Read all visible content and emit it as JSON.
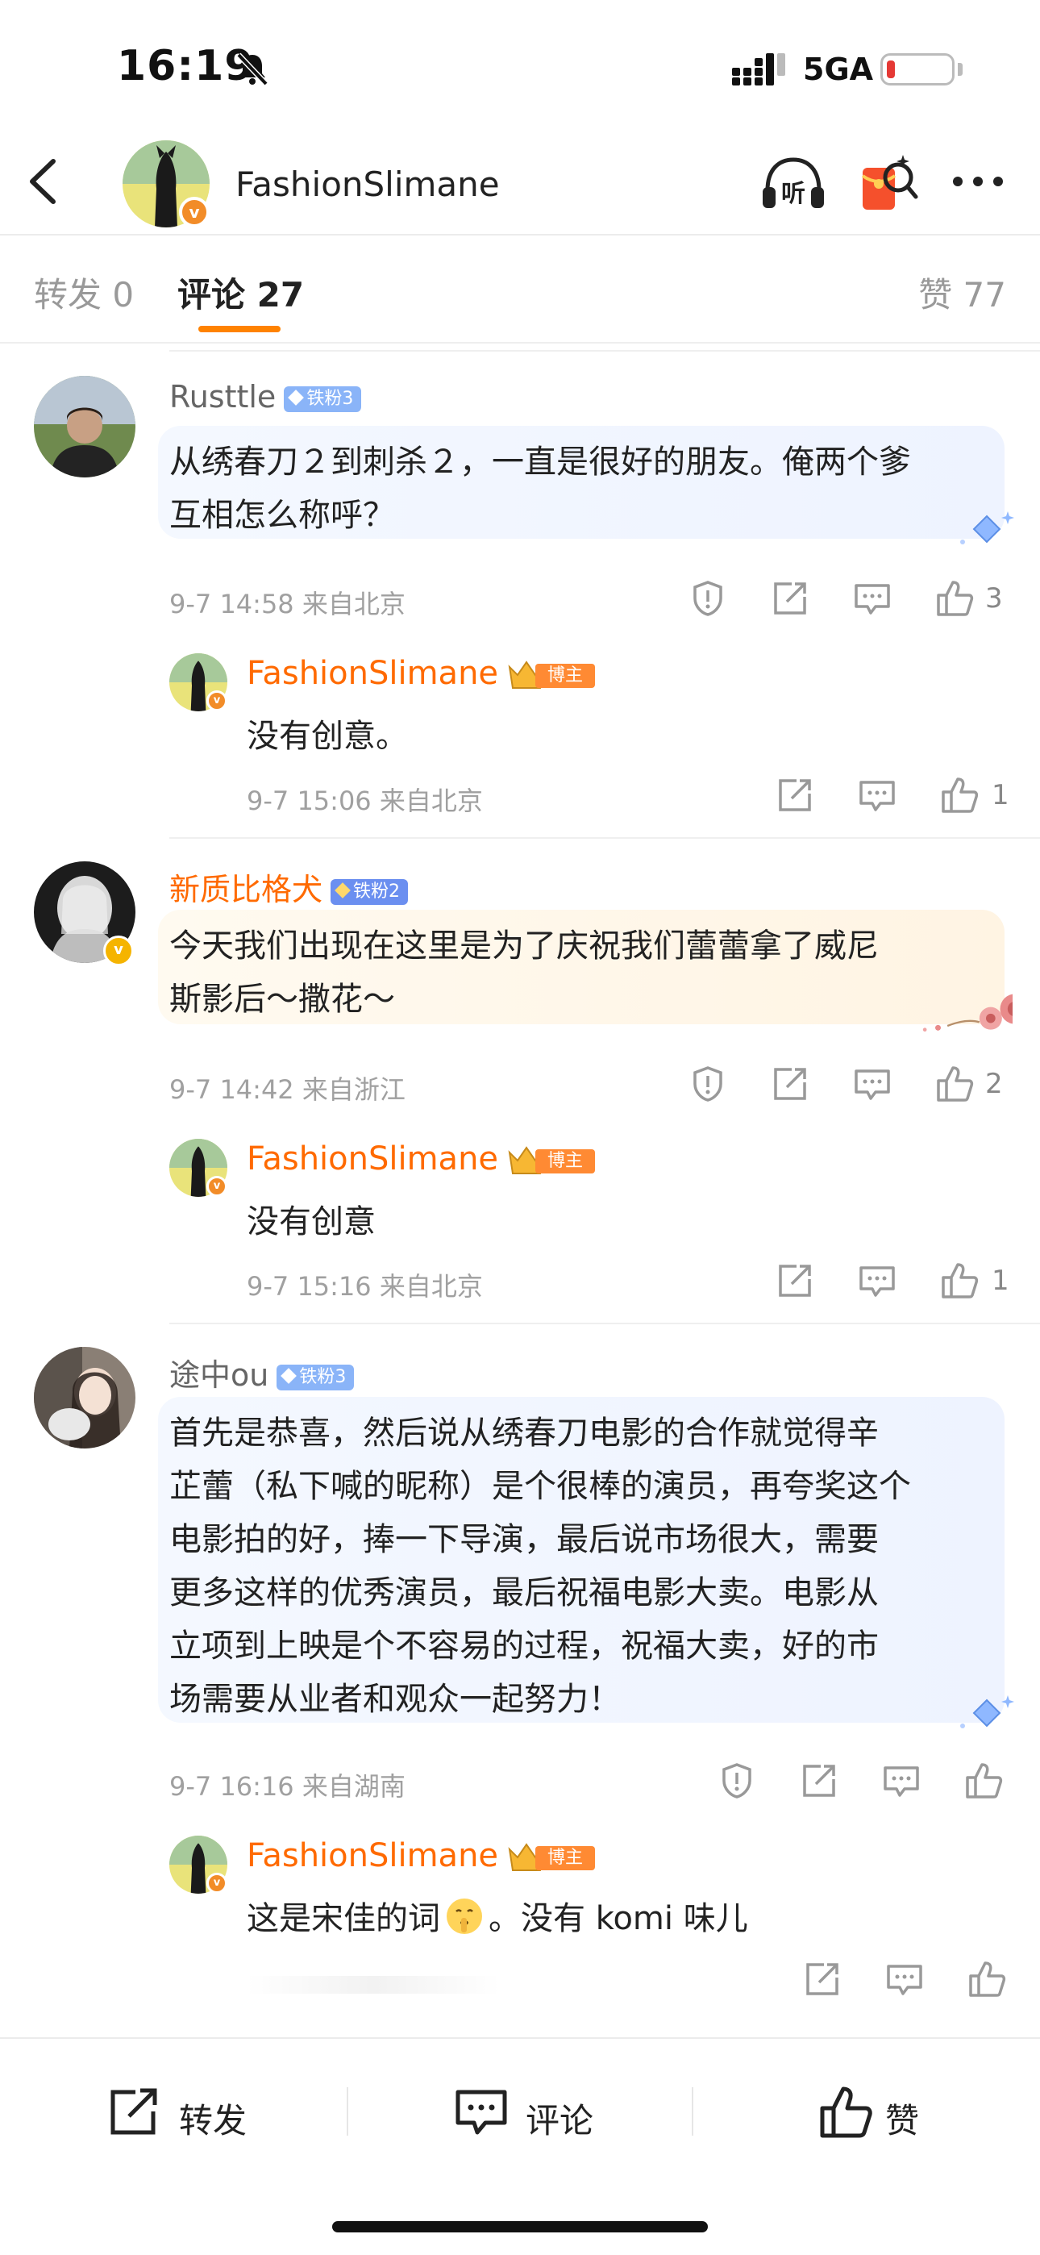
{
  "status_bar": {
    "time": "16:19",
    "network": "5GA",
    "battery_color": "#e53935"
  },
  "header": {
    "username": "FashionSlimane",
    "icons": [
      "back-icon",
      "listen-icon",
      "hongbao-icon",
      "more-icon"
    ],
    "listen_label": "听"
  },
  "tabs": {
    "forward": "转发 0",
    "comments": "评论 27",
    "likes": "赞 77",
    "active_color": "#ff8200"
  },
  "comments": [
    {
      "name": "Rusttle",
      "badge": "铁粉3",
      "text_lines": [
        "从绣春刀２到刺杀２，一直是很好的朋友。俺两个爹",
        "互相怎么称呼？"
      ],
      "meta": "9-7 14:58  来自北京",
      "likes": "3",
      "reply": {
        "name": "FashionSlimane",
        "badge": "博主",
        "text": "没有创意。",
        "meta": "9-7 15:06  来自北京",
        "likes": "1"
      }
    },
    {
      "name": "新质比格犬",
      "badge": "铁粉2",
      "text_lines": [
        "今天我们出现在这里是为了庆祝我们蕾蕾拿了威尼",
        "斯影后～撒花～"
      ],
      "meta": "9-7 14:42  来自浙江",
      "likes": "2",
      "reply": {
        "name": "FashionSlimane",
        "badge": "博主",
        "text": "没有创意",
        "meta": "9-7 15:16  来自北京",
        "likes": "1"
      }
    },
    {
      "name": "途中ou",
      "badge": "铁粉3",
      "text_lines": [
        "首先是恭喜，然后说从绣春刀电影的合作就觉得辛",
        "芷蕾（私下喊的昵称）是个很棒的演员，再夸奖这个",
        "电影拍的好，捧一下导演，最后说市场很大，需要",
        "更多这样的优秀演员，最后祝福电影大卖。电影从",
        "立项到上映是个不容易的过程，祝福大卖，好的市",
        "场需要从业者和观众一起努力！"
      ],
      "meta": "9-7 16:16  来自湖南",
      "likes": "",
      "reply": {
        "name": "FashionSlimane",
        "badge": "博主",
        "text_before": "这是宋佳的词",
        "text_after": "。没有 komi 味儿",
        "meta": "",
        "likes": ""
      }
    }
  ],
  "bottom_bar": {
    "forward": "转发",
    "comment": "评论",
    "like": "赞"
  }
}
